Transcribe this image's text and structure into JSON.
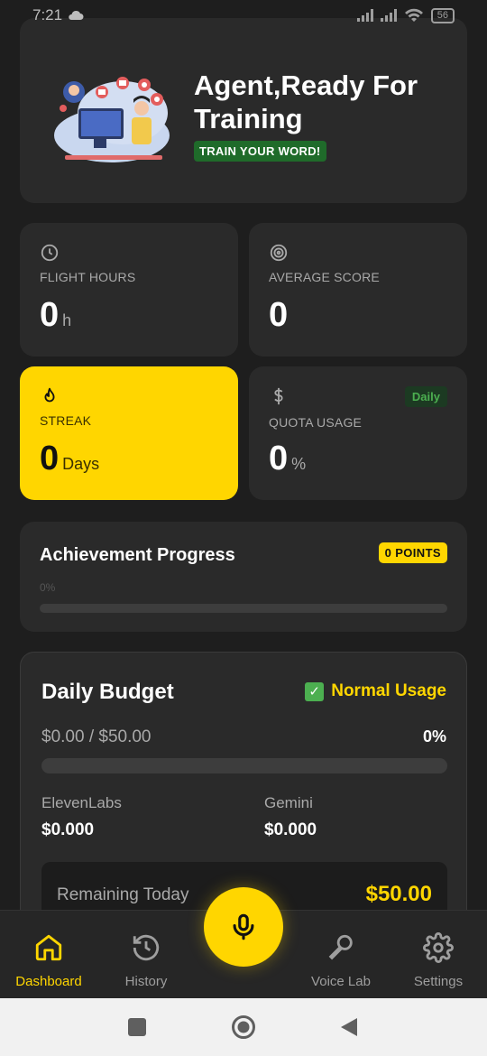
{
  "status_bar": {
    "time": "7:21",
    "battery": "56"
  },
  "hero": {
    "title": "Agent,Ready For Training",
    "badge": "TRAIN YOUR WORD!"
  },
  "stats": {
    "flight_hours": {
      "label": "FLIGHT HOURS",
      "value": "0",
      "unit": "h"
    },
    "average_score": {
      "label": "AVERAGE SCORE",
      "value": "0"
    },
    "streak": {
      "label": "STREAK",
      "value": "0",
      "unit": "Days"
    },
    "quota_usage": {
      "label": "QUOTA USAGE",
      "value": "0",
      "unit": "%",
      "tag": "Daily"
    }
  },
  "achievement": {
    "title": "Achievement Progress",
    "points": "0 POINTS",
    "percent_text": "0%",
    "progress": 0
  },
  "budget": {
    "title": "Daily Budget",
    "status": "Normal Usage",
    "amount": "$0.00 / $50.00",
    "percent": "0%",
    "progress": 0,
    "providers": [
      {
        "name": "ElevenLabs",
        "value": "$0.000"
      },
      {
        "name": "Gemini",
        "value": "$0.000"
      }
    ],
    "remaining_label": "Remaining Today",
    "remaining_value": "$50.00"
  },
  "tabs": [
    {
      "label": "Dashboard",
      "icon": "home-icon",
      "active": true
    },
    {
      "label": "History",
      "icon": "history-icon",
      "active": false
    },
    {
      "label": "Voice Lab",
      "icon": "microphone-outline-icon",
      "active": false
    },
    {
      "label": "Settings",
      "icon": "gear-icon",
      "active": false
    }
  ],
  "colors": {
    "accent": "#ffd600",
    "background": "#1e1e1e",
    "card": "#2a2a2a",
    "success": "#4caf50"
  }
}
